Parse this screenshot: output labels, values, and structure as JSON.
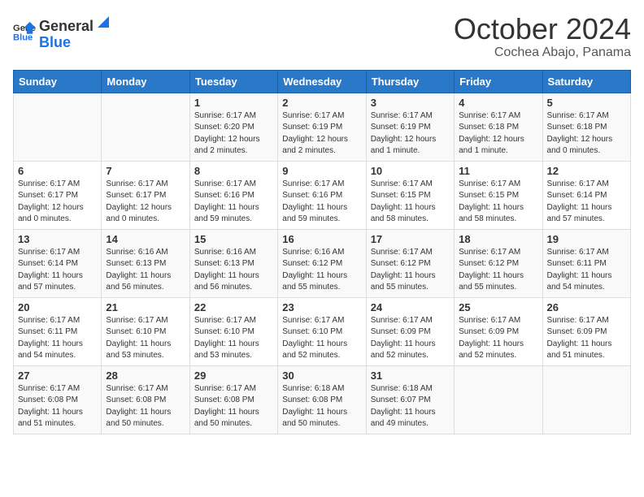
{
  "header": {
    "logo_general": "General",
    "logo_blue": "Blue",
    "month_title": "October 2024",
    "subtitle": "Cochea Abajo, Panama"
  },
  "days_of_week": [
    "Sunday",
    "Monday",
    "Tuesday",
    "Wednesday",
    "Thursday",
    "Friday",
    "Saturday"
  ],
  "weeks": [
    [
      {
        "day": "",
        "content": ""
      },
      {
        "day": "",
        "content": ""
      },
      {
        "day": "1",
        "content": "Sunrise: 6:17 AM\nSunset: 6:20 PM\nDaylight: 12 hours and 2 minutes."
      },
      {
        "day": "2",
        "content": "Sunrise: 6:17 AM\nSunset: 6:19 PM\nDaylight: 12 hours and 2 minutes."
      },
      {
        "day": "3",
        "content": "Sunrise: 6:17 AM\nSunset: 6:19 PM\nDaylight: 12 hours and 1 minute."
      },
      {
        "day": "4",
        "content": "Sunrise: 6:17 AM\nSunset: 6:18 PM\nDaylight: 12 hours and 1 minute."
      },
      {
        "day": "5",
        "content": "Sunrise: 6:17 AM\nSunset: 6:18 PM\nDaylight: 12 hours and 0 minutes."
      }
    ],
    [
      {
        "day": "6",
        "content": "Sunrise: 6:17 AM\nSunset: 6:17 PM\nDaylight: 12 hours and 0 minutes."
      },
      {
        "day": "7",
        "content": "Sunrise: 6:17 AM\nSunset: 6:17 PM\nDaylight: 12 hours and 0 minutes."
      },
      {
        "day": "8",
        "content": "Sunrise: 6:17 AM\nSunset: 6:16 PM\nDaylight: 11 hours and 59 minutes."
      },
      {
        "day": "9",
        "content": "Sunrise: 6:17 AM\nSunset: 6:16 PM\nDaylight: 11 hours and 59 minutes."
      },
      {
        "day": "10",
        "content": "Sunrise: 6:17 AM\nSunset: 6:15 PM\nDaylight: 11 hours and 58 minutes."
      },
      {
        "day": "11",
        "content": "Sunrise: 6:17 AM\nSunset: 6:15 PM\nDaylight: 11 hours and 58 minutes."
      },
      {
        "day": "12",
        "content": "Sunrise: 6:17 AM\nSunset: 6:14 PM\nDaylight: 11 hours and 57 minutes."
      }
    ],
    [
      {
        "day": "13",
        "content": "Sunrise: 6:17 AM\nSunset: 6:14 PM\nDaylight: 11 hours and 57 minutes."
      },
      {
        "day": "14",
        "content": "Sunrise: 6:16 AM\nSunset: 6:13 PM\nDaylight: 11 hours and 56 minutes."
      },
      {
        "day": "15",
        "content": "Sunrise: 6:16 AM\nSunset: 6:13 PM\nDaylight: 11 hours and 56 minutes."
      },
      {
        "day": "16",
        "content": "Sunrise: 6:16 AM\nSunset: 6:12 PM\nDaylight: 11 hours and 55 minutes."
      },
      {
        "day": "17",
        "content": "Sunrise: 6:17 AM\nSunset: 6:12 PM\nDaylight: 11 hours and 55 minutes."
      },
      {
        "day": "18",
        "content": "Sunrise: 6:17 AM\nSunset: 6:12 PM\nDaylight: 11 hours and 55 minutes."
      },
      {
        "day": "19",
        "content": "Sunrise: 6:17 AM\nSunset: 6:11 PM\nDaylight: 11 hours and 54 minutes."
      }
    ],
    [
      {
        "day": "20",
        "content": "Sunrise: 6:17 AM\nSunset: 6:11 PM\nDaylight: 11 hours and 54 minutes."
      },
      {
        "day": "21",
        "content": "Sunrise: 6:17 AM\nSunset: 6:10 PM\nDaylight: 11 hours and 53 minutes."
      },
      {
        "day": "22",
        "content": "Sunrise: 6:17 AM\nSunset: 6:10 PM\nDaylight: 11 hours and 53 minutes."
      },
      {
        "day": "23",
        "content": "Sunrise: 6:17 AM\nSunset: 6:10 PM\nDaylight: 11 hours and 52 minutes."
      },
      {
        "day": "24",
        "content": "Sunrise: 6:17 AM\nSunset: 6:09 PM\nDaylight: 11 hours and 52 minutes."
      },
      {
        "day": "25",
        "content": "Sunrise: 6:17 AM\nSunset: 6:09 PM\nDaylight: 11 hours and 52 minutes."
      },
      {
        "day": "26",
        "content": "Sunrise: 6:17 AM\nSunset: 6:09 PM\nDaylight: 11 hours and 51 minutes."
      }
    ],
    [
      {
        "day": "27",
        "content": "Sunrise: 6:17 AM\nSunset: 6:08 PM\nDaylight: 11 hours and 51 minutes."
      },
      {
        "day": "28",
        "content": "Sunrise: 6:17 AM\nSunset: 6:08 PM\nDaylight: 11 hours and 50 minutes."
      },
      {
        "day": "29",
        "content": "Sunrise: 6:17 AM\nSunset: 6:08 PM\nDaylight: 11 hours and 50 minutes."
      },
      {
        "day": "30",
        "content": "Sunrise: 6:18 AM\nSunset: 6:08 PM\nDaylight: 11 hours and 50 minutes."
      },
      {
        "day": "31",
        "content": "Sunrise: 6:18 AM\nSunset: 6:07 PM\nDaylight: 11 hours and 49 minutes."
      },
      {
        "day": "",
        "content": ""
      },
      {
        "day": "",
        "content": ""
      }
    ]
  ]
}
